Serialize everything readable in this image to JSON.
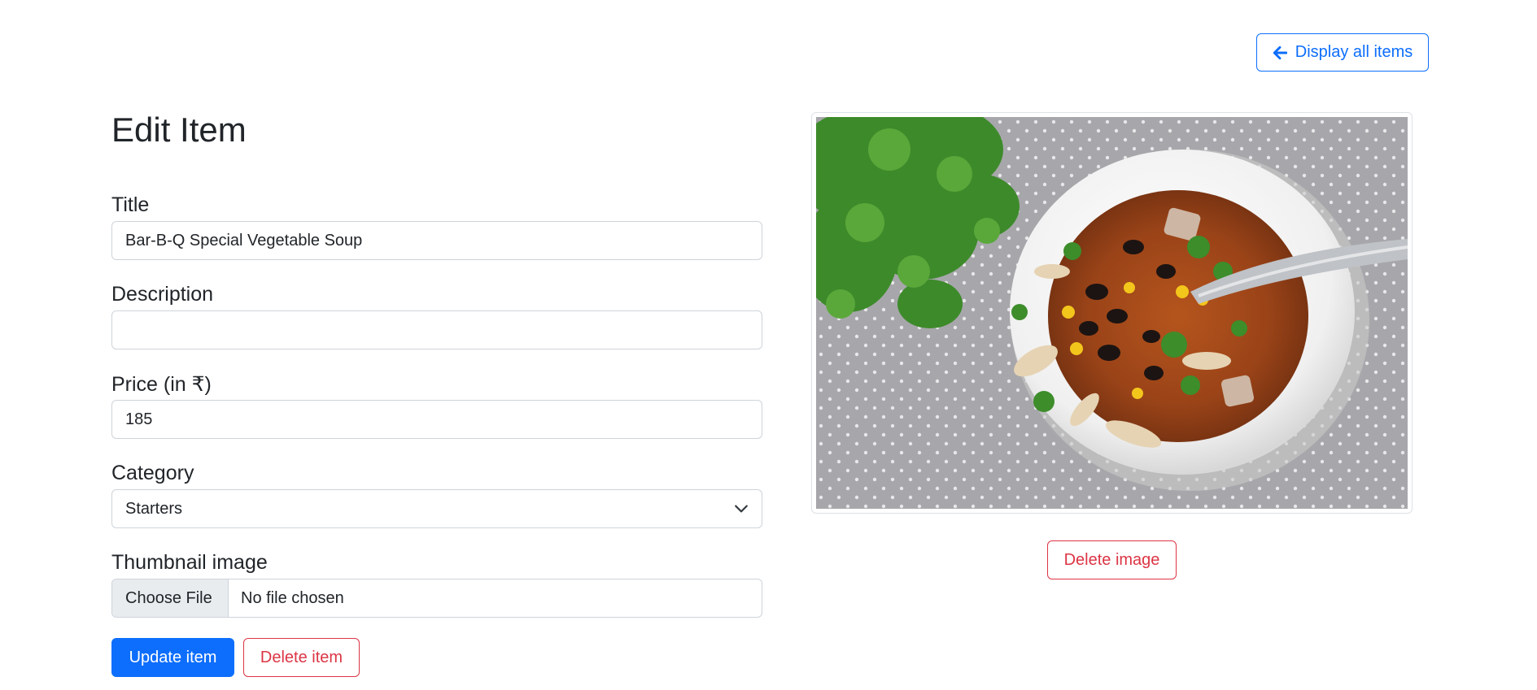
{
  "header": {
    "back_button_label": "Display all items",
    "back_icon": "arrow-left-icon"
  },
  "form": {
    "heading": "Edit Item",
    "title_label": "Title",
    "title_value": "Bar-B-Q Special Vegetable Soup",
    "description_label": "Description",
    "description_value": "",
    "price_label": "Price (in ₹)",
    "price_value": "185",
    "category_label": "Category",
    "category_selected": "Starters",
    "thumbnail_label": "Thumbnail image",
    "choose_file_label": "Choose File",
    "file_status": "No file chosen",
    "update_button_label": "Update item",
    "delete_button_label": "Delete item"
  },
  "thumbnail": {
    "image": "bowl-of-soup-with-beans-corn-cilantro-photo",
    "delete_image_label": "Delete image"
  },
  "colors": {
    "primary": "#0d6efd",
    "danger": "#dc3545",
    "border": "#ced4da"
  }
}
